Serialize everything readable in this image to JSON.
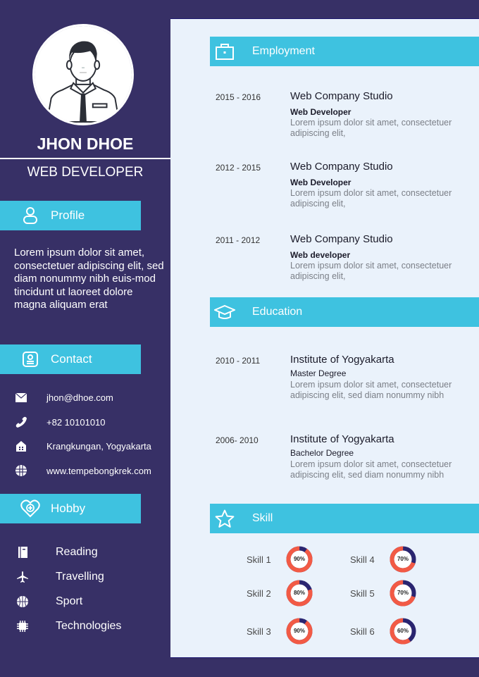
{
  "person": {
    "name": "JHON DHOE",
    "role": "WEB DEVELOPER"
  },
  "profile": {
    "heading": "Profile",
    "icon": "user-icon",
    "text": "Lorem ipsum dolor sit amet, consectetuer adipiscing elit, sed diam nonummy nibh euis-mod tincidunt ut laoreet dolore magna aliquam erat"
  },
  "contact": {
    "heading": "Contact",
    "icon": "contact-card-icon",
    "items": [
      {
        "icon": "mail-icon",
        "text": "jhon@dhoe.com"
      },
      {
        "icon": "phone-icon",
        "text": "+82 10101010"
      },
      {
        "icon": "home-icon",
        "text": "Krangkungan, Yogyakarta"
      },
      {
        "icon": "globe-icon",
        "text": "www.tempebongkrek.com"
      }
    ]
  },
  "hobby": {
    "heading": "Hobby",
    "icon": "heart-plus-icon",
    "items": [
      {
        "icon": "book-icon",
        "text": "Reading"
      },
      {
        "icon": "airplane-icon",
        "text": "Travelling"
      },
      {
        "icon": "basketball-icon",
        "text": "Sport"
      },
      {
        "icon": "chip-icon",
        "text": "Technologies"
      }
    ]
  },
  "employment": {
    "heading": "Employment",
    "icon": "briefcase-icon",
    "items": [
      {
        "years": "2015 - 2016",
        "company": "Web Company Studio",
        "position": "Web Developer",
        "desc": "Lorem ipsum dolor sit amet, consectetuer adipiscing elit,"
      },
      {
        "years": "2012 - 2015",
        "company": "Web Company Studio",
        "position": "Web Developer",
        "desc": "Lorem ipsum dolor sit amet, consectetuer adipiscing elit,"
      },
      {
        "years": "2011 - 2012",
        "company": "Web Company Studio",
        "position": "Web developer",
        "desc": "Lorem ipsum dolor sit amet, consectetuer adipiscing elit,"
      }
    ]
  },
  "education": {
    "heading": "Education",
    "icon": "graduation-cap-icon",
    "items": [
      {
        "years": "2010 - 2011",
        "school": "Institute of Yogyakarta",
        "degree": "Master Degree",
        "desc": "Lorem ipsum dolor sit amet, consectetuer adipiscing elit, sed diam nonummy nibh"
      },
      {
        "years": "2006- 2010",
        "school": "Institute of Yogyakarta",
        "degree": "Bachelor Degree",
        "desc": "Lorem ipsum dolor sit amet, consectetuer adipiscing elit, sed diam nonummy nibh"
      }
    ]
  },
  "skill": {
    "heading": "Skill",
    "icon": "star-icon",
    "items": [
      {
        "name": "Skill 1",
        "label": "90%",
        "value": 90
      },
      {
        "name": "Skill 2",
        "label": "80%",
        "value": 80
      },
      {
        "name": "Skill 3",
        "label": "90%",
        "value": 90
      },
      {
        "name": "Skill 4",
        "label": "70%",
        "value": 70
      },
      {
        "name": "Skill 5",
        "label": "70%",
        "value": 70
      },
      {
        "name": "Skill 6",
        "label": "60%",
        "value": 60
      }
    ]
  },
  "colors": {
    "sidebar_bg": "#373066",
    "accent": "#3ec2e0",
    "panel_bg": "#eaf2fb",
    "donut_primary": "#f25a45",
    "donut_remainder": "#2a2570"
  }
}
